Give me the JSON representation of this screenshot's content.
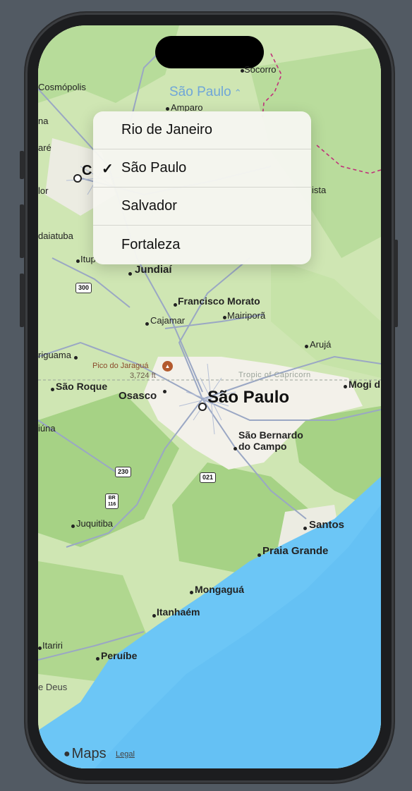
{
  "map_title": {
    "label": "São Paulo",
    "chevron": "⌃⌄"
  },
  "city_menu": {
    "items": [
      {
        "label": "Rio de Janeiro",
        "selected": false
      },
      {
        "label": "São Paulo",
        "selected": true
      },
      {
        "label": "Salvador",
        "selected": false
      },
      {
        "label": "Fortaleza",
        "selected": false
      }
    ],
    "check_glyph": "✓"
  },
  "places": {
    "socorro": "Socorro",
    "amparo": "Amparo",
    "cosmopolis": "Cosmópolis",
    "ca": "C",
    "na": "na",
    "are": "aré",
    "lor": "lor",
    "ista": "ista",
    "indaiatuba": "daiatuba",
    "itup": "Itup",
    "jundiai": "Jundiaí",
    "francisco_morato": "Francisco Morato",
    "mairipora": "Mairiporã",
    "cajamar": "Cajamar",
    "aruja": "Arujá",
    "riguama": "riguama",
    "pico": "Pico do Jaraguá",
    "pico_height": "3,724 ft",
    "tropic": "Tropic of Capricorn",
    "sao_roque": "São Roque",
    "osasco": "Osasco",
    "sao_paulo": "São Paulo",
    "mogi": "Mogi d",
    "iuna": "iúna",
    "sao_bernardo_1": "São Bernardo",
    "sao_bernardo_2": "do Campo",
    "juquitiba": "Juquitiba",
    "santos": "Santos",
    "praia_grande": "Praia Grande",
    "mongagua": "Mongaguá",
    "itanhaem": "Itanhaém",
    "itariri": "Itariri",
    "peruibe": "Peruíbe",
    "de_deus": "e Deus"
  },
  "shields": {
    "r300": "300",
    "r230": "230",
    "r021": "021",
    "br116_top": "BR",
    "br116_bottom": "116"
  },
  "footer": {
    "maps_label": "Maps",
    "legal_label": "Legal"
  },
  "colors": {
    "land": "#cfe6b3",
    "forest": "#a9d48a",
    "urban": "#f3f1ea",
    "road": "#9aa7c4",
    "ocean": "#6cc6f6",
    "border": "#c0307a",
    "title": "#6fa6d8"
  }
}
